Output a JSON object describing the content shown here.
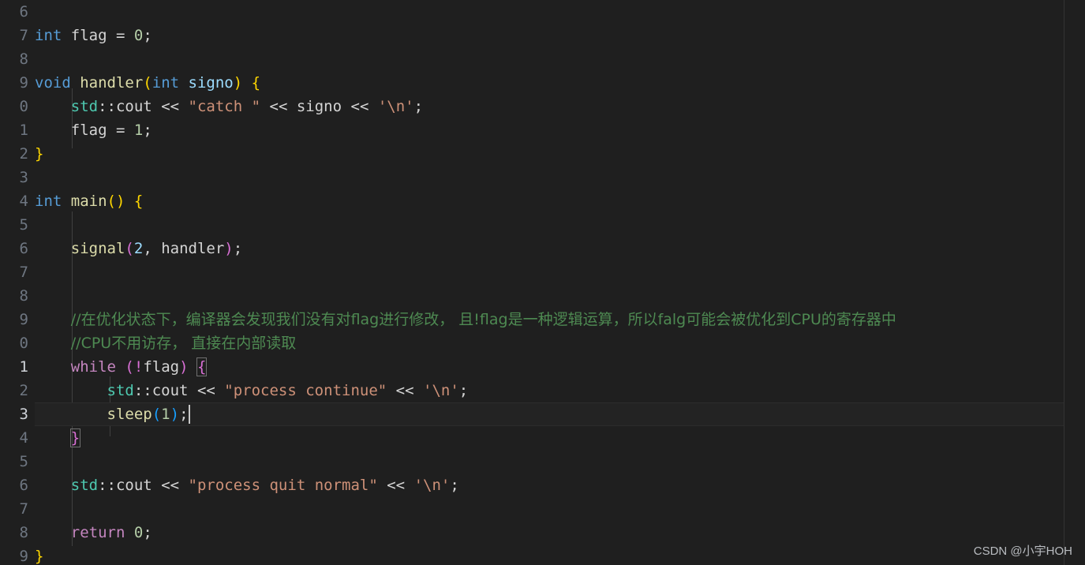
{
  "editor": {
    "theme": "dark-plus",
    "background": "#1f1f1f",
    "gutter_background": "#1f1f1f",
    "current_line_background": "#232323",
    "line_height_px": 30,
    "font_size_px": 19,
    "cursor_line": 23,
    "cursor_column_after": "sleep(1);"
  },
  "gutter": {
    "line_numbers": [
      {
        "n": "6",
        "active": false
      },
      {
        "n": "7",
        "active": false
      },
      {
        "n": "8",
        "active": false
      },
      {
        "n": "9",
        "active": false
      },
      {
        "n": "0",
        "active": false
      },
      {
        "n": "1",
        "active": false
      },
      {
        "n": "2",
        "active": false
      },
      {
        "n": "3",
        "active": false
      },
      {
        "n": "4",
        "active": false
      },
      {
        "n": "5",
        "active": false
      },
      {
        "n": "6",
        "active": false
      },
      {
        "n": "7",
        "active": false
      },
      {
        "n": "8",
        "active": false
      },
      {
        "n": "9",
        "active": false
      },
      {
        "n": "0",
        "active": false
      },
      {
        "n": "1",
        "active": true
      },
      {
        "n": "2",
        "active": false
      },
      {
        "n": "3",
        "active": true
      },
      {
        "n": "4",
        "active": false
      },
      {
        "n": "5",
        "active": false
      },
      {
        "n": "6",
        "active": false
      },
      {
        "n": "7",
        "active": false
      },
      {
        "n": "8",
        "active": false
      },
      {
        "n": "9",
        "active": false
      }
    ]
  },
  "code": {
    "language": "cpp",
    "lines": [
      {
        "id": 1,
        "text": ""
      },
      {
        "id": 2,
        "text": "int flag = 0;"
      },
      {
        "id": 3,
        "text": ""
      },
      {
        "id": 4,
        "text": "void handler(int signo) {"
      },
      {
        "id": 5,
        "text": "    std::cout << \"catch \" << signo << '\\n';"
      },
      {
        "id": 6,
        "text": "    flag = 1;"
      },
      {
        "id": 7,
        "text": "}"
      },
      {
        "id": 8,
        "text": ""
      },
      {
        "id": 9,
        "text": "int main() {"
      },
      {
        "id": 10,
        "text": ""
      },
      {
        "id": 11,
        "text": "    signal(2, handler);"
      },
      {
        "id": 12,
        "text": ""
      },
      {
        "id": 13,
        "text": ""
      },
      {
        "id": 14,
        "text": "    //在优化状态下，编译器会发现我们没有对flag进行修改， 且!flag是一种逻辑运算，所以falg可能会被优化到CPU的寄存器中"
      },
      {
        "id": 15,
        "text": "    //CPU不用访存， 直接在内部读取"
      },
      {
        "id": 16,
        "text": "    while (!flag) {"
      },
      {
        "id": 17,
        "text": "        std::cout << \"process continue\" << '\\n';"
      },
      {
        "id": 18,
        "text": "        sleep(1);"
      },
      {
        "id": 19,
        "text": "    }"
      },
      {
        "id": 20,
        "text": ""
      },
      {
        "id": 21,
        "text": "    std::cout << \"process quit normal\" << '\\n';"
      },
      {
        "id": 22,
        "text": ""
      },
      {
        "id": 23,
        "text": "    return 0;"
      },
      {
        "id": 24,
        "text": "}"
      }
    ],
    "comments": {
      "comment_1": "//在优化状态下，编译器会发现我们没有对flag进行修改， 且!flag是一种逻辑运算，所以falg可能会被优化到CPU的寄存器中",
      "comment_2": "//CPU不用访存， 直接在内部读取"
    },
    "strings": {
      "catch": "\"catch \"",
      "process_continue": "\"process continue\"",
      "process_quit_normal": "\"process quit normal\"",
      "newline_char": "'\\n'"
    }
  },
  "tokens": {
    "l2": [
      {
        "t": "int",
        "c": "t-kw-blue"
      },
      {
        "t": " ",
        "c": "t-plain"
      },
      {
        "t": "flag",
        "c": "t-plain"
      },
      {
        "t": " ",
        "c": "t-plain"
      },
      {
        "t": "=",
        "c": "t-op"
      },
      {
        "t": " ",
        "c": "t-plain"
      },
      {
        "t": "0",
        "c": "t-num"
      },
      {
        "t": ";",
        "c": "t-plain"
      }
    ],
    "l4": [
      {
        "t": "void",
        "c": "t-kw-blue"
      },
      {
        "t": " ",
        "c": "t-plain"
      },
      {
        "t": "handler",
        "c": "t-fn"
      },
      {
        "t": "(",
        "c": "t-br-yellow"
      },
      {
        "t": "int",
        "c": "t-kw-blue"
      },
      {
        "t": " ",
        "c": "t-plain"
      },
      {
        "t": "signo",
        "c": "t-param"
      },
      {
        "t": ")",
        "c": "t-br-yellow"
      },
      {
        "t": " ",
        "c": "t-plain"
      },
      {
        "t": "{",
        "c": "t-br-yellow"
      }
    ],
    "l5": [
      {
        "t": "    ",
        "c": "t-plain"
      },
      {
        "t": "std",
        "c": "t-ns"
      },
      {
        "t": "::",
        "c": "t-plain"
      },
      {
        "t": "cout",
        "c": "t-plain"
      },
      {
        "t": " ",
        "c": "t-plain"
      },
      {
        "t": "<<",
        "c": "t-op"
      },
      {
        "t": " ",
        "c": "t-plain"
      },
      {
        "t": "\"catch \"",
        "c": "t-str"
      },
      {
        "t": " ",
        "c": "t-plain"
      },
      {
        "t": "<<",
        "c": "t-op"
      },
      {
        "t": " ",
        "c": "t-plain"
      },
      {
        "t": "signo",
        "c": "t-plain"
      },
      {
        "t": " ",
        "c": "t-plain"
      },
      {
        "t": "<<",
        "c": "t-op"
      },
      {
        "t": " ",
        "c": "t-plain"
      },
      {
        "t": "'\\n'",
        "c": "t-str"
      },
      {
        "t": ";",
        "c": "t-plain"
      }
    ],
    "l6": [
      {
        "t": "    ",
        "c": "t-plain"
      },
      {
        "t": "flag",
        "c": "t-plain"
      },
      {
        "t": " ",
        "c": "t-plain"
      },
      {
        "t": "=",
        "c": "t-op"
      },
      {
        "t": " ",
        "c": "t-plain"
      },
      {
        "t": "1",
        "c": "t-num"
      },
      {
        "t": ";",
        "c": "t-plain"
      }
    ],
    "l7": [
      {
        "t": "}",
        "c": "t-br-yellow"
      }
    ],
    "l9": [
      {
        "t": "int",
        "c": "t-kw-blue"
      },
      {
        "t": " ",
        "c": "t-plain"
      },
      {
        "t": "main",
        "c": "t-fn"
      },
      {
        "t": "()",
        "c": "t-br-yellow"
      },
      {
        "t": " ",
        "c": "t-plain"
      },
      {
        "t": "{",
        "c": "t-br-yellow"
      }
    ],
    "l11": [
      {
        "t": "    ",
        "c": "t-plain"
      },
      {
        "t": "signal",
        "c": "t-fn"
      },
      {
        "t": "(",
        "c": "t-br-pink"
      },
      {
        "t": "2",
        "c": "t-param"
      },
      {
        "t": ", ",
        "c": "t-plain"
      },
      {
        "t": "handler",
        "c": "t-plain"
      },
      {
        "t": ")",
        "c": "t-br-pink"
      },
      {
        "t": ";",
        "c": "t-plain"
      }
    ],
    "l16": [
      {
        "t": "    ",
        "c": "t-plain"
      },
      {
        "t": "while",
        "c": "t-kw-ctrl"
      },
      {
        "t": " ",
        "c": "t-plain"
      },
      {
        "t": "(",
        "c": "t-br-pink"
      },
      {
        "t": "!",
        "c": "t-br-pink"
      },
      {
        "t": "flag",
        "c": "t-plain"
      },
      {
        "t": ")",
        "c": "t-br-pink"
      },
      {
        "t": " ",
        "c": "t-plain"
      }
    ],
    "l16_brace": "{",
    "l17": [
      {
        "t": "        ",
        "c": "t-plain"
      },
      {
        "t": "std",
        "c": "t-ns"
      },
      {
        "t": "::",
        "c": "t-plain"
      },
      {
        "t": "cout",
        "c": "t-plain"
      },
      {
        "t": " ",
        "c": "t-plain"
      },
      {
        "t": "<<",
        "c": "t-op"
      },
      {
        "t": " ",
        "c": "t-plain"
      },
      {
        "t": "\"process continue\"",
        "c": "t-str"
      },
      {
        "t": " ",
        "c": "t-plain"
      },
      {
        "t": "<<",
        "c": "t-op"
      },
      {
        "t": " ",
        "c": "t-plain"
      },
      {
        "t": "'\\n'",
        "c": "t-str"
      },
      {
        "t": ";",
        "c": "t-plain"
      }
    ],
    "l18": [
      {
        "t": "        ",
        "c": "t-plain"
      },
      {
        "t": "sleep",
        "c": "t-fn"
      },
      {
        "t": "(",
        "c": "t-br-blue"
      },
      {
        "t": "1",
        "c": "t-num"
      },
      {
        "t": ")",
        "c": "t-br-blue"
      },
      {
        "t": ";",
        "c": "t-plain"
      }
    ],
    "l19_indent": "    ",
    "l19_brace": "}",
    "l21": [
      {
        "t": "    ",
        "c": "t-plain"
      },
      {
        "t": "std",
        "c": "t-ns"
      },
      {
        "t": "::",
        "c": "t-plain"
      },
      {
        "t": "cout",
        "c": "t-plain"
      },
      {
        "t": " ",
        "c": "t-plain"
      },
      {
        "t": "<<",
        "c": "t-op"
      },
      {
        "t": " ",
        "c": "t-plain"
      },
      {
        "t": "\"process quit normal\"",
        "c": "t-str"
      },
      {
        "t": " ",
        "c": "t-plain"
      },
      {
        "t": "<<",
        "c": "t-op"
      },
      {
        "t": " ",
        "c": "t-plain"
      },
      {
        "t": "'\\n'",
        "c": "t-str"
      },
      {
        "t": ";",
        "c": "t-plain"
      }
    ],
    "l23": [
      {
        "t": "    ",
        "c": "t-plain"
      },
      {
        "t": "return",
        "c": "t-kw-ctrl"
      },
      {
        "t": " ",
        "c": "t-plain"
      },
      {
        "t": "0",
        "c": "t-num"
      },
      {
        "t": ";",
        "c": "t-plain"
      }
    ],
    "l24": [
      {
        "t": "}",
        "c": "t-br-yellow"
      }
    ]
  },
  "watermark": {
    "text": "CSDN @小宇HOH"
  }
}
